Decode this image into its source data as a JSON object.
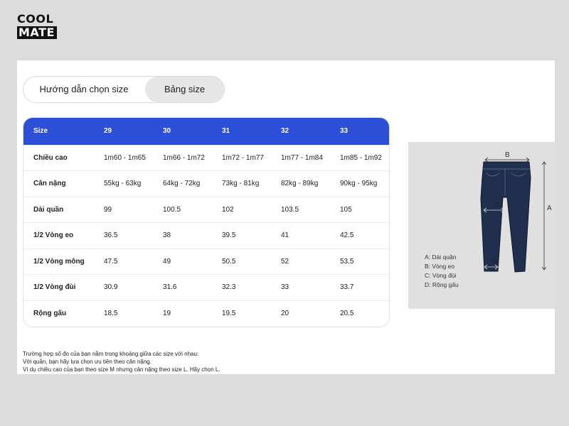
{
  "brand": {
    "line1": "COOL",
    "line2": "MATE"
  },
  "tabs": [
    {
      "label": "Hướng dẫn chọn size",
      "active": false
    },
    {
      "label": "Bảng size",
      "active": true
    }
  ],
  "size_table": {
    "header": [
      "Size",
      "29",
      "30",
      "31",
      "32",
      "33"
    ],
    "rows": [
      [
        "Chiều cao",
        "1m60 - 1m65",
        "1m66 - 1m72",
        "1m72 - 1m77",
        "1m77 - 1m84",
        "1m85 - 1m92"
      ],
      [
        "Cân nặng",
        "55kg - 63kg",
        "64kg - 72kg",
        "73kg - 81kg",
        "82kg - 89kg",
        "90kg - 95kg"
      ],
      [
        "Dài quần",
        "99",
        "100.5",
        "102",
        "103.5",
        "105"
      ],
      [
        "1/2 Vòng eo",
        "36.5",
        "38",
        "39.5",
        "41",
        "42.5"
      ],
      [
        "1/2 Vòng mông",
        "47.5",
        "49",
        "50.5",
        "52",
        "53.5"
      ],
      [
        "1/2 Vòng đùi",
        "30.9",
        "31.6",
        "32.3",
        "33",
        "33.7"
      ],
      [
        "Rộng gấu",
        "18.5",
        "19",
        "19.5",
        "20",
        "20.5"
      ]
    ],
    "header_color": "#2b4fd6"
  },
  "notes": [
    "Trường hợp số đo của bạn nằm trong khoảng giữa các size với nhau:",
    "Với quần, bạn hãy lựa chọn ưu tiên theo cân nặng.",
    "Ví dụ chiều cao của bạn theo size M nhưng cân nặng theo size L. Hãy chọn L."
  ],
  "diagram": {
    "labels": {
      "A": "A",
      "B": "B",
      "C": "C",
      "D": "D"
    },
    "legend": [
      "A: Dài quần",
      "B: Vòng eo",
      "C: Vòng đùi",
      "D: Rộng gấu"
    ],
    "jeans_color": "#1f2f4d"
  }
}
